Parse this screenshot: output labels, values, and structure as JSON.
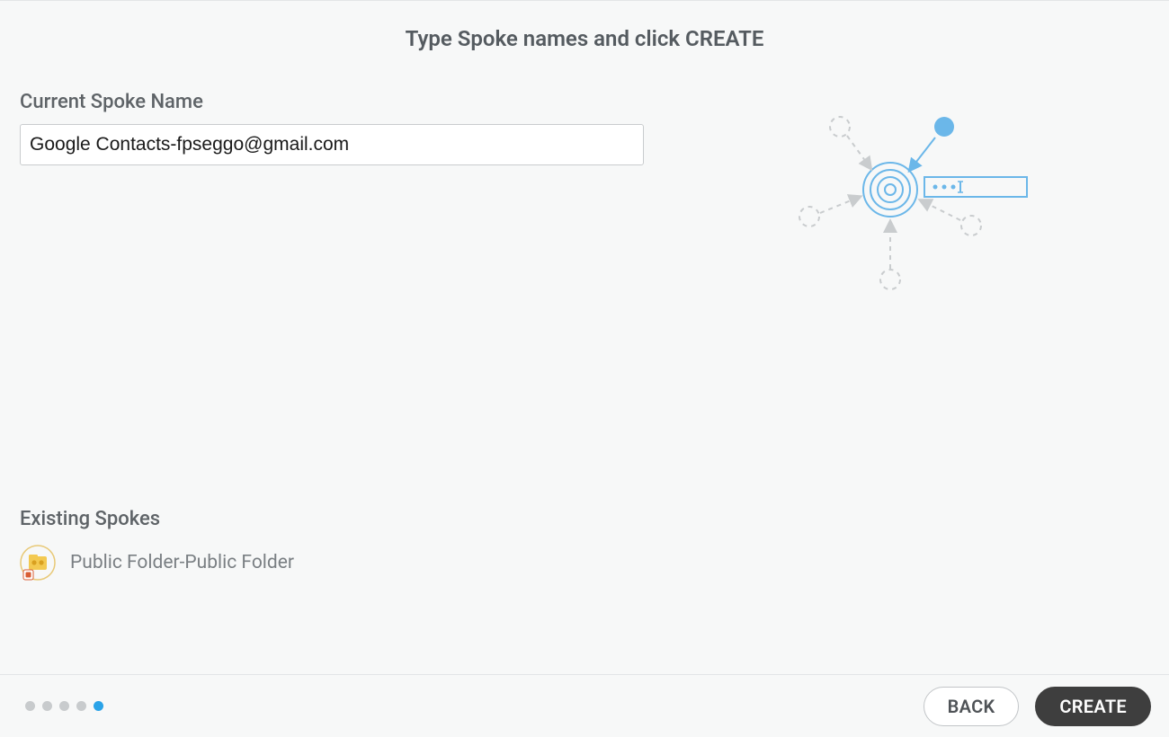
{
  "header": {
    "title": "Type Spoke names and click CREATE"
  },
  "form": {
    "currentSpoke": {
      "label": "Current Spoke Name",
      "value": "Google Contacts-fpseggo@gmail.com"
    }
  },
  "existing": {
    "label": "Existing Spokes",
    "items": [
      {
        "name": "Public Folder-Public Folder",
        "icon": "public-folder"
      }
    ]
  },
  "footer": {
    "step_count": 5,
    "active_step_index": 4,
    "back_label": "BACK",
    "create_label": "CREATE"
  },
  "colors": {
    "accent_blue": "#2aa3e8",
    "illus_blue": "#6bb7e9",
    "grey_text": "#5e6367",
    "button_dark": "#3e3e3e"
  }
}
